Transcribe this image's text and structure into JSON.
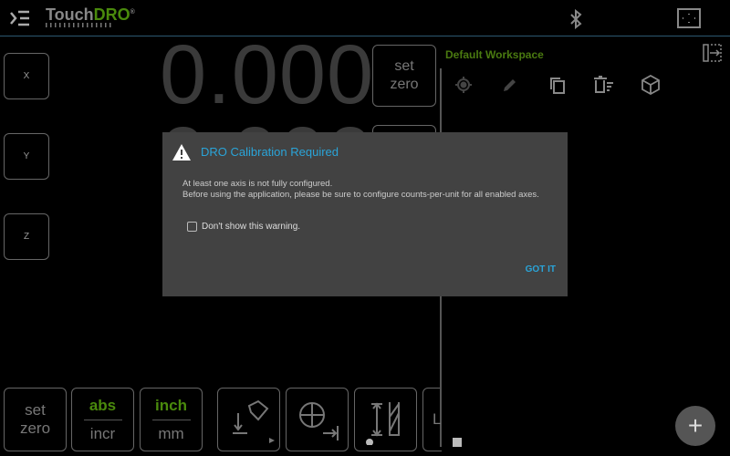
{
  "header": {
    "logo_text_a": "Touch",
    "logo_text_b": "DRO",
    "logo_reg": "®",
    "icons": [
      "menu-icon",
      "bluetooth-icon",
      "fullscreen-icon"
    ]
  },
  "axes": [
    {
      "label": "X",
      "value": "0.000"
    },
    {
      "label": "Y",
      "value": "0.000"
    },
    {
      "label": "Z",
      "value": ""
    }
  ],
  "set_zero": {
    "line1": "set",
    "line2": "zero"
  },
  "workspace": {
    "title": "Default Workspace",
    "icons": [
      "target-icon",
      "pencil-icon",
      "copy-icon",
      "delete-list-icon",
      "cube-icon",
      "panel-exit-icon"
    ]
  },
  "bottom": {
    "set_zero": {
      "line1": "set",
      "line2": "zero"
    },
    "abs_incr": {
      "active": "abs",
      "inactive": "incr"
    },
    "units": {
      "active": "inch",
      "inactive": "mm"
    },
    "partial_label": "L"
  },
  "colors": {
    "accent_green": "#4a8a0c",
    "dialog_title": "#2aa4d8",
    "dialog_bg": "#424242"
  },
  "dialog": {
    "title": "DRO Calibration Required",
    "line1": "At least one axis is not fully configured.",
    "line2": "Before using the application, please be sure to configure counts-per-unit for all enabled axes.",
    "checkbox_label": "Don't show this warning.",
    "checkbox_checked": false,
    "ok": "GOT IT"
  },
  "fab": "+"
}
